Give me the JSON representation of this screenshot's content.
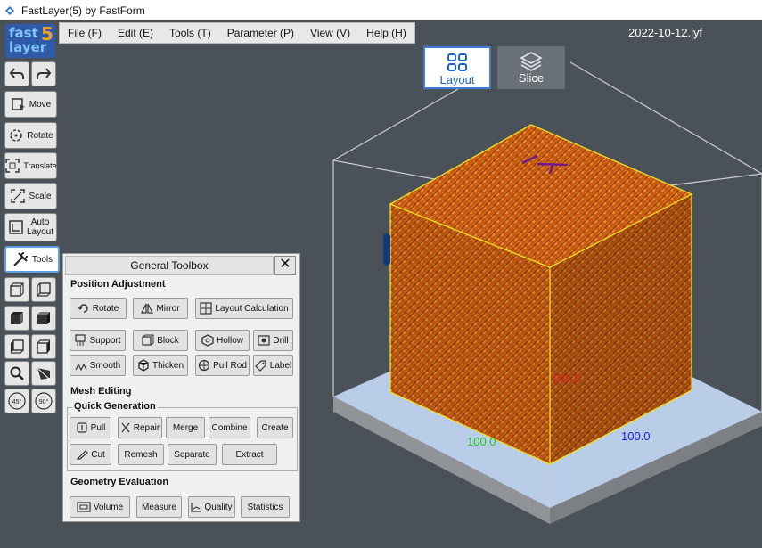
{
  "window": {
    "title": "FastLayer(5) by FastForm"
  },
  "logo": {
    "line1": "fast",
    "line2": "layer",
    "version": "5"
  },
  "menu": [
    {
      "label": "File (F)"
    },
    {
      "label": "Edit (E)"
    },
    {
      "label": "Tools (T)"
    },
    {
      "label": "Parameter (P)"
    },
    {
      "label": "View (V)"
    },
    {
      "label": "Help (H)"
    }
  ],
  "filename": "2022-10-12.lyf",
  "modes": {
    "layout": "Layout",
    "slice": "Slice",
    "active": "layout"
  },
  "left_toolbar": {
    "move": "Move",
    "rotate": "Rotate",
    "translate": "Translate",
    "scale": "Scale",
    "auto_layout_1": "Auto",
    "auto_layout_2": "Layout",
    "tools": "Tools",
    "rot45": "45°",
    "rot90": "90°"
  },
  "toolbox": {
    "title": "General Toolbox",
    "close": "✕",
    "position_adjustment": "Position Adjustment",
    "rotate": "Rotate",
    "mirror": "Mirror",
    "layout_calc": "Layout Calculation",
    "support": "Support",
    "block": "Block",
    "hollow": "Hollow",
    "drill": "Drill",
    "smooth": "Smooth",
    "thicken": "Thicken",
    "pull_rod": "Pull Rod",
    "label": "Label",
    "mesh_editing": "Mesh Editing",
    "quick_generation": "Quick Generation",
    "pull": "Pull",
    "repair": "Repair",
    "merge": "Merge",
    "combine": "Combine",
    "create": "Create",
    "cut": "Cut",
    "remesh": "Remesh",
    "separate": "Separate",
    "extract": "Extract",
    "geometry_evaluation": "Geometry Evaluation",
    "volume": "Volume",
    "measure": "Measure",
    "quality": "Quality",
    "statistics": "Statistics"
  },
  "scene": {
    "x_dim": "100.0",
    "y_dim": "100.0",
    "z_dim": "100.0",
    "colors": {
      "x": "#22c522",
      "y": "#1a22d8",
      "z": "#e02020",
      "lattice": "#e87a1e",
      "bbox": "#f0e020",
      "platform": "#b9cde8"
    }
  }
}
